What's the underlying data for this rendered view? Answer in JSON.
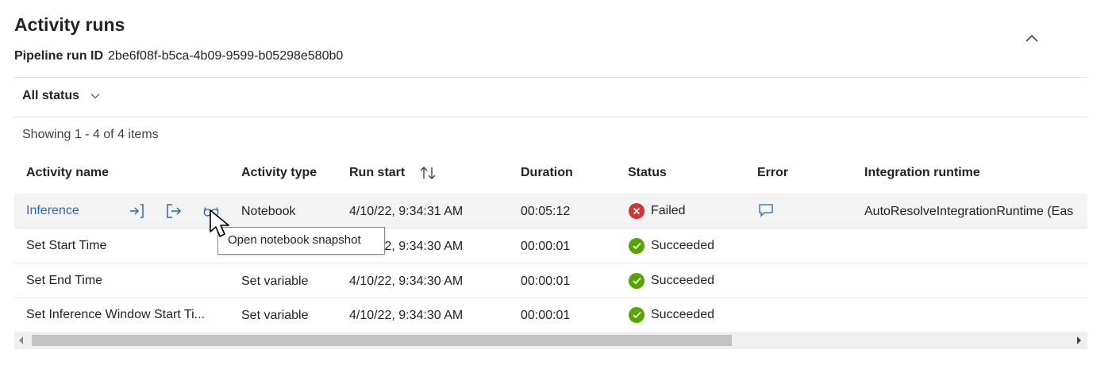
{
  "header": {
    "title": "Activity runs",
    "run_id_label": "Pipeline run ID",
    "run_id": "2be6f08f-b5ca-4b09-9599-b05298e580b0",
    "collapse_icon": "chevron-up-icon"
  },
  "filter": {
    "status_label": "All status"
  },
  "showing": "Showing 1 - 4 of 4 items",
  "columns": {
    "activity_name": "Activity name",
    "activity_type": "Activity type",
    "run_start": "Run start",
    "duration": "Duration",
    "status": "Status",
    "error": "Error",
    "integration_runtime": "Integration runtime"
  },
  "rows": [
    {
      "activity_name": "Inference",
      "activity_type": "Notebook",
      "run_start": "4/10/22, 9:34:31 AM",
      "duration": "00:05:12",
      "status": "Failed",
      "integration_runtime": "AutoResolveIntegrationRuntime (Eas"
    },
    {
      "activity_name": "Set Start Time",
      "activity_type": "",
      "run_start": "4/10/22, 9:34:30 AM",
      "duration": "00:00:01",
      "status": "Succeeded",
      "integration_runtime": ""
    },
    {
      "activity_name": "Set End Time",
      "activity_type": "Set variable",
      "run_start": "4/10/22, 9:34:30 AM",
      "duration": "00:00:01",
      "status": "Succeeded",
      "integration_runtime": ""
    },
    {
      "activity_name": "Set Inference Window Start Ti...",
      "activity_type": "Set variable",
      "run_start": "4/10/22, 9:34:30 AM",
      "duration": "00:00:01",
      "status": "Succeeded",
      "integration_runtime": ""
    }
  ],
  "tooltip": "Open notebook snapshot",
  "colors": {
    "link": "#2a6bb5",
    "failed": "#d13438",
    "succeeded": "#57a300",
    "row_highlight": "#f3f3f3"
  }
}
